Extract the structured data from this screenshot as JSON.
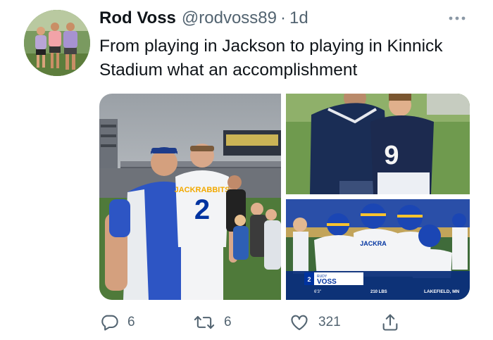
{
  "tweet": {
    "author_name": "Rod Voss",
    "author_handle": "@rodvoss89",
    "separator": "·",
    "time_ago": "1d",
    "text": "From playing in Jackson to playing in Kinnick Stadium what an accomplishment"
  },
  "media": {
    "photo1": {
      "jersey_text": "JACKRABBITS",
      "jersey_number": "2"
    },
    "photo2": {
      "jersey_number": "9"
    },
    "photo3": {
      "jersey_text": "JACKRA",
      "caption_number": "2",
      "caption_name": "VOSS",
      "caption_prefix": "RUDY",
      "caption_height": "6'3\"",
      "caption_weight": "210 LBS",
      "caption_hometown": "LAKEFIELD, MN"
    }
  },
  "actions": {
    "reply_count": "6",
    "retweet_count": "6",
    "like_count": "321"
  },
  "icons": {
    "reply": "comment-icon",
    "retweet": "retweet-icon",
    "like": "heart-icon",
    "share": "share-icon",
    "more": "more-dots-icon"
  },
  "colors": {
    "text_primary": "#0f1419",
    "text_secondary": "#536471",
    "jersey_blue": "#0033a0",
    "jersey_yellow": "#f9c22e"
  }
}
